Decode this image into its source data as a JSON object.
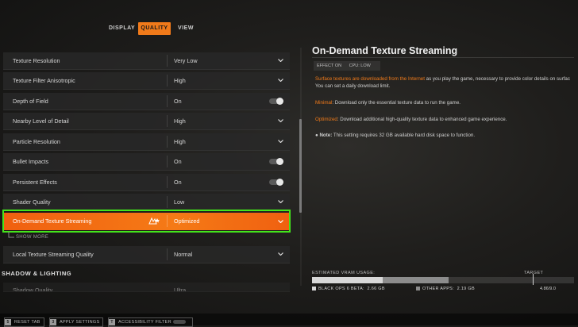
{
  "tabs": [
    {
      "label": "DISPLAY",
      "active": false
    },
    {
      "label": "QUALITY",
      "active": true
    },
    {
      "label": "VIEW",
      "active": false
    }
  ],
  "settings_rows": [
    {
      "label": "Texture Resolution",
      "value": "Very Low",
      "control": "dropdown"
    },
    {
      "label": "Texture Filter Anisotropic",
      "value": "High",
      "control": "dropdown"
    },
    {
      "label": "Depth of Field",
      "value": "On",
      "control": "toggle"
    },
    {
      "label": "Nearby Level of Detail",
      "value": "High",
      "control": "dropdown"
    },
    {
      "label": "Particle Resolution",
      "value": "High",
      "control": "dropdown"
    },
    {
      "label": "Bullet Impacts",
      "value": "On",
      "control": "toggle"
    },
    {
      "label": "Persistent Effects",
      "value": "On",
      "control": "toggle"
    },
    {
      "label": "Shader Quality",
      "value": "Low",
      "control": "dropdown"
    },
    {
      "label": "On-Demand Texture Streaming",
      "value": "Optimized",
      "control": "dropdown",
      "highlighted": true
    },
    {
      "label": "Local Texture Streaming Quality",
      "value": "Normal",
      "control": "dropdown"
    }
  ],
  "show_more": "SHOW MORE",
  "section_header": "SHADOW & LIGHTING",
  "partial_row": {
    "label": "Shadow Quality",
    "value": "Ultra"
  },
  "detail": {
    "title": "On-Demand Texture Streaming",
    "effects": {
      "left": "EFFECT ON",
      "right": "CPU: LOW"
    },
    "line1_orange": "Surface textures are downloaded from the Internet",
    "line1_rest": " as you play the game, necessary to provide color details on surfac",
    "line2": "You can set a daily download limit.",
    "minimal_label": "Minimal",
    "minimal_text": ": Download only the essential texture data to run the game.",
    "optimized_label": "Optimized",
    "optimized_text": ": Download additional high-quality texture data to enhanced game experience.",
    "note_label": "Note:",
    "note_text": " This setting requires 32 GB available hard disk space to function."
  },
  "vram": {
    "label": "ESTIMATED VRAM USAGE:",
    "target_label": "TARGET",
    "game_label": "BLACK OPS 6 BETA:",
    "game_value": "2.66 GB",
    "other_label": "OTHER APPS:",
    "other_value": "2.19 GB",
    "total": "4.86/9.0",
    "game_fraction": 0.27,
    "other_fraction": 0.25,
    "colors": {
      "game": "#d8d8d8",
      "other": "#8c8c8c"
    }
  },
  "footer": [
    {
      "key": "5",
      "label": "RESET TAB"
    },
    {
      "key": "3",
      "label": "APPLY SETTINGS"
    },
    {
      "key": "T",
      "label": "ACCESSIBILITY FILTER"
    }
  ],
  "colors": {
    "accent": "#f07a1a",
    "highlight_frame": "#43e51c"
  }
}
